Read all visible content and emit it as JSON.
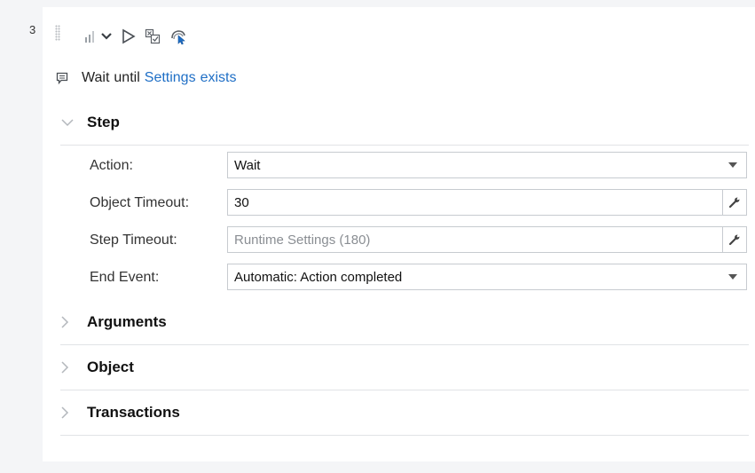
{
  "step": {
    "number": "3",
    "toolbar": {
      "icons": [
        "bar-chart-icon",
        "chevron-down-icon",
        "play-icon",
        "copy-checkbox-icon",
        "pointer-object-icon"
      ]
    },
    "summary": {
      "verb": "Wait",
      "connector": "until",
      "object": "Settings",
      "condition": "exists"
    }
  },
  "sections": {
    "step": {
      "title": "Step",
      "expanded": true,
      "fields": {
        "action": {
          "label": "Action:",
          "value": "Wait"
        },
        "object_timeout": {
          "label": "Object Timeout:",
          "value": "30"
        },
        "step_timeout": {
          "label": "Step Timeout:",
          "placeholder": "Runtime Settings (180)"
        },
        "end_event": {
          "label": "End Event:",
          "value": "Automatic: Action completed"
        }
      }
    },
    "arguments": {
      "title": "Arguments",
      "expanded": false
    },
    "object": {
      "title": "Object",
      "expanded": false
    },
    "transactions": {
      "title": "Transactions",
      "expanded": false
    }
  },
  "colors": {
    "link": "#1f6fc6",
    "border": "#c7cbd0",
    "divider": "#e1e3e6",
    "background": "#f4f5f7"
  }
}
